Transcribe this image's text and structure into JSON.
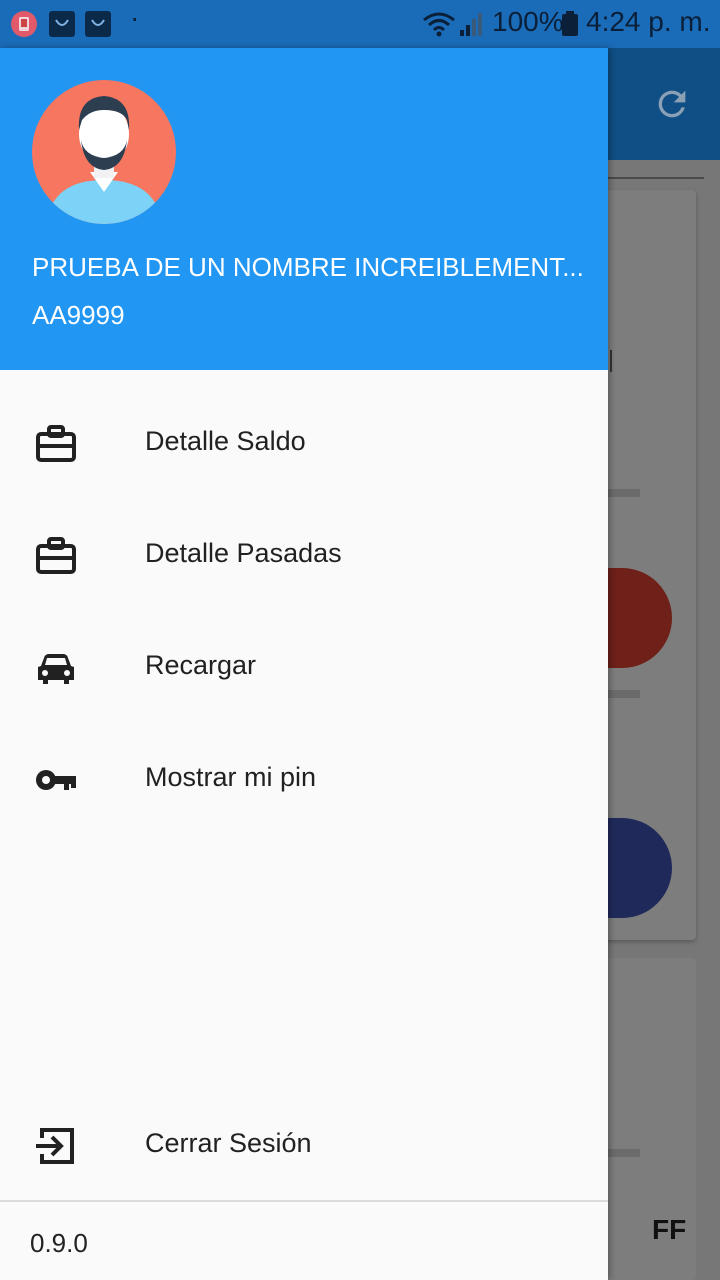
{
  "status_bar": {
    "battery": "100%",
    "time": "4:24 p. m.",
    "dot": "·"
  },
  "drawer": {
    "user_name": "PRUEBA DE UN NOMBRE INCREIBLEMENT...",
    "user_id": "AA9999",
    "menu": [
      {
        "label": "Detalle Saldo",
        "icon": "briefcase-icon"
      },
      {
        "label": "Detalle Pasadas",
        "icon": "briefcase-icon"
      },
      {
        "label": "Recargar",
        "icon": "car-icon"
      },
      {
        "label": "Mostrar mi pin",
        "icon": "key-icon"
      }
    ],
    "logout_label": "Cerrar Sesión",
    "version": "0.9.0"
  },
  "background": {
    "partial_text": "FF"
  },
  "colors": {
    "header": "#2196f3",
    "drawer_bg": "#fafafa",
    "status_bar": "#1a6bb8"
  }
}
